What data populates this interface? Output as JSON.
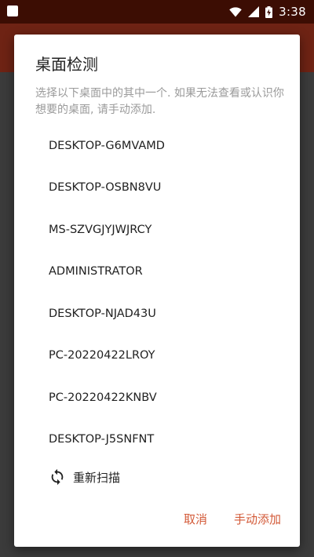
{
  "status_bar": {
    "time": "3:38",
    "icons": [
      "wifi-icon",
      "cellular-signal-icon",
      "battery-charging-icon"
    ]
  },
  "dialog": {
    "title": "桌面检测",
    "description": "选择以下桌面中的其中一个. 如果无法查看或认识你想要的桌面, 请手动添加.",
    "devices": [
      "DESKTOP-G6MVAMD",
      "DESKTOP-OSBN8VU",
      "MS-SZVGJYJWJRCY",
      "ADMINISTRATOR",
      "DESKTOP-NJAD43U",
      "PC-20220422LROY",
      "PC-20220422KNBV",
      "DESKTOP-J5SNFNT"
    ],
    "rescan_label": "重新扫描",
    "rescan_icon": "refresh-icon",
    "cancel_label": "取消",
    "manual_add_label": "手动添加"
  },
  "colors": {
    "status_bar": "#3c0d03",
    "app_header": "#6e2314",
    "accent": "#d35a38"
  }
}
